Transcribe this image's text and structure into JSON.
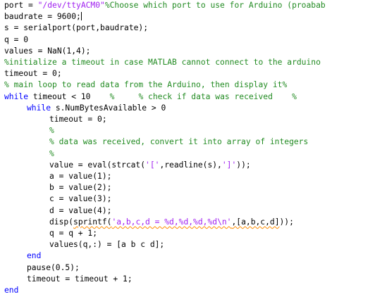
{
  "editor": {
    "language": "MATLAB",
    "colors": {
      "normal": "#000000",
      "keyword": "#0000ff",
      "string": "#a020f0",
      "comment": "#228b22",
      "warning_underline": "#ff8c00"
    },
    "lines": [
      {
        "indent": 0,
        "segments": [
          {
            "type": "normal",
            "text": "port = "
          },
          {
            "type": "string",
            "text": "\"/dev/ttyACM0\""
          },
          {
            "type": "comment",
            "text": "%Choose which port to use for Arduino (proabab"
          }
        ]
      },
      {
        "indent": 0,
        "caret": true,
        "segments": [
          {
            "type": "normal",
            "text": "baudrate = 9600;"
          }
        ]
      },
      {
        "indent": 0,
        "segments": [
          {
            "type": "normal",
            "text": "s = serialport(port,baudrate);"
          }
        ]
      },
      {
        "indent": 0,
        "segments": [
          {
            "type": "normal",
            "text": "q = 0"
          }
        ]
      },
      {
        "indent": 0,
        "segments": [
          {
            "type": "normal",
            "text": "values = NaN(1,4);"
          }
        ]
      },
      {
        "indent": 0,
        "segments": [
          {
            "type": "comment",
            "text": "%initialize a timeout in case MATLAB cannot connect to the arduino"
          }
        ]
      },
      {
        "indent": 0,
        "segments": [
          {
            "type": "normal",
            "text": "timeout = 0;"
          }
        ]
      },
      {
        "indent": 0,
        "segments": [
          {
            "type": "comment",
            "text": "% main loop to read data from the Arduino, then display it%"
          }
        ]
      },
      {
        "indent": 0,
        "segments": [
          {
            "type": "keyword",
            "text": "while"
          },
          {
            "type": "normal",
            "text": " timeout < 10    "
          },
          {
            "type": "comment",
            "text": "%     % check if data was received    %"
          }
        ]
      },
      {
        "indent": 1,
        "segments": [
          {
            "type": "keyword",
            "text": "while"
          },
          {
            "type": "normal",
            "text": " s.NumBytesAvailable > 0"
          }
        ]
      },
      {
        "indent": 2,
        "segments": [
          {
            "type": "normal",
            "text": "timeout = 0;"
          }
        ]
      },
      {
        "indent": 2,
        "segments": [
          {
            "type": "comment",
            "text": "%"
          }
        ]
      },
      {
        "indent": 2,
        "segments": [
          {
            "type": "comment",
            "text": "% data was received, convert it into array of integers"
          }
        ]
      },
      {
        "indent": 2,
        "segments": [
          {
            "type": "comment",
            "text": "%"
          }
        ]
      },
      {
        "indent": 2,
        "segments": [
          {
            "type": "normal",
            "text": "value = eval(strcat("
          },
          {
            "type": "string",
            "text": "'['"
          },
          {
            "type": "normal",
            "text": ",readline(s),"
          },
          {
            "type": "string",
            "text": "']'"
          },
          {
            "type": "normal",
            "text": "));"
          }
        ]
      },
      {
        "indent": 2,
        "segments": [
          {
            "type": "normal",
            "text": "a = value(1);"
          }
        ]
      },
      {
        "indent": 2,
        "segments": [
          {
            "type": "normal",
            "text": "b = value(2);"
          }
        ]
      },
      {
        "indent": 2,
        "segments": [
          {
            "type": "normal",
            "text": "c = value(3);"
          }
        ]
      },
      {
        "indent": 2,
        "segments": [
          {
            "type": "normal",
            "text": "d = value(4);"
          }
        ]
      },
      {
        "indent": 2,
        "segments": [
          {
            "type": "normal",
            "text": "disp(",
            "warning": false
          },
          {
            "type": "normal",
            "text": "sprintf(",
            "warning": true
          },
          {
            "type": "string",
            "text": "'a,b,c,d = %d,%d,%d,%d\\n'",
            "warning": true
          },
          {
            "type": "normal",
            "text": ",[a,b,c,d]",
            "warning": true
          },
          {
            "type": "normal",
            "text": "));"
          }
        ]
      },
      {
        "indent": 2,
        "segments": [
          {
            "type": "normal",
            "text": "q = q + 1;"
          }
        ]
      },
      {
        "indent": 2,
        "segments": [
          {
            "type": "normal",
            "text": "values(q,:) = [a b c d];"
          }
        ]
      },
      {
        "indent": 1,
        "segments": [
          {
            "type": "keyword",
            "text": "end"
          }
        ]
      },
      {
        "indent": 1,
        "segments": [
          {
            "type": "normal",
            "text": "pause(0.5);"
          }
        ]
      },
      {
        "indent": 1,
        "segments": [
          {
            "type": "normal",
            "text": "timeout = timeout + 1;"
          }
        ]
      },
      {
        "indent": 0,
        "segments": [
          {
            "type": "keyword",
            "text": "end"
          }
        ]
      }
    ]
  }
}
